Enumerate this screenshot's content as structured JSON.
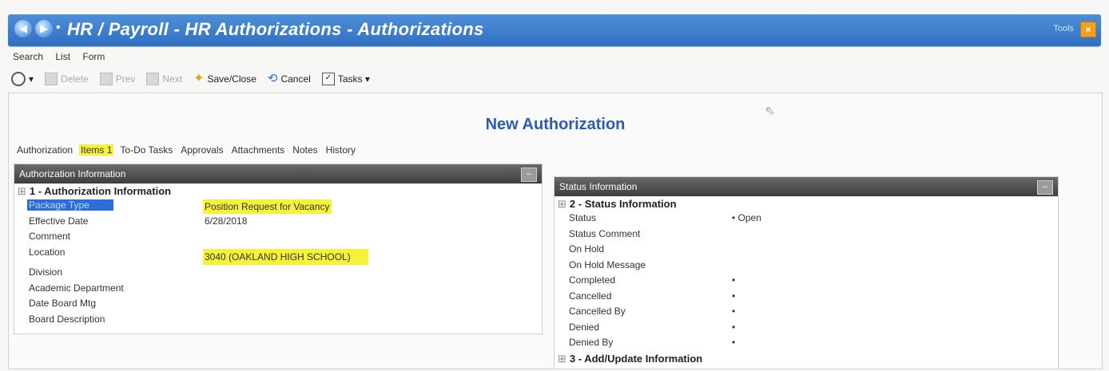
{
  "window": {
    "title": "HR / Payroll - HR Authorizations - Authorizations",
    "tools_label": "Tools",
    "close_glyph": "×"
  },
  "menu": [
    "Search",
    "List",
    "Form"
  ],
  "toolbar": {
    "delete": "Delete",
    "prev": "Prev",
    "next": "Next",
    "save_close": "Save/Close",
    "cancel": "Cancel",
    "tasks": "Tasks"
  },
  "page_heading": "New Authorization",
  "tabs": [
    "Authorization",
    "Items 1",
    "To-Do Tasks",
    "Approvals",
    "Attachments",
    "Notes",
    "History"
  ],
  "auth_panel": {
    "header": "Authorization Information",
    "section_title": "1 - Authorization Information",
    "rows": [
      {
        "label": "Package Type",
        "value": "Position Request for Vacancy"
      },
      {
        "label": "Effective Date",
        "value": "6/28/2018"
      },
      {
        "label": "Comment",
        "value": ""
      },
      {
        "label": "Location",
        "value": "3040 (OAKLAND HIGH SCHOOL)"
      },
      {
        "label": "Division",
        "value": ""
      },
      {
        "label": "Academic Department",
        "value": ""
      },
      {
        "label": "Date Board Mtg",
        "value": ""
      },
      {
        "label": "Board Description",
        "value": ""
      }
    ]
  },
  "status_panel": {
    "header": "Status Information",
    "section_title": "2 - Status Information",
    "rows": [
      {
        "label": "Status",
        "value": "• Open"
      },
      {
        "label": "Status Comment",
        "value": ""
      },
      {
        "label": "On Hold",
        "value": ""
      },
      {
        "label": "On Hold Message",
        "value": ""
      },
      {
        "label": "Completed",
        "value": "•"
      },
      {
        "label": "Cancelled",
        "value": "•"
      },
      {
        "label": "Cancelled By",
        "value": "•"
      },
      {
        "label": "Denied",
        "value": "•"
      },
      {
        "label": "Denied By",
        "value": "•"
      }
    ],
    "next_section": "3 - Add/Update Information"
  },
  "colors": {
    "titlebar": "#2f6fc0",
    "heading": "#2c5bb4",
    "highlight": "#f6f23a",
    "panel_header": "#3e3e3e"
  }
}
